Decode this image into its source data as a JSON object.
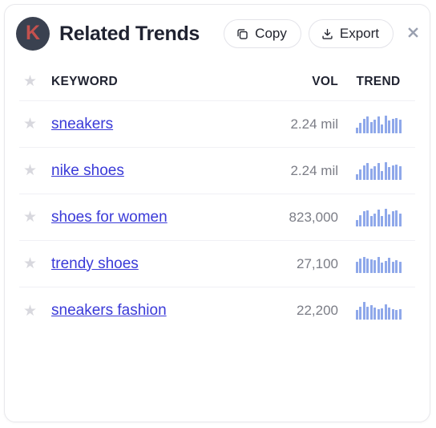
{
  "panel": {
    "logo_letter": "K",
    "logo_bg_color": "#3a4150",
    "logo_letter_color": "#c4514e",
    "title": "Related Trends"
  },
  "toolbar": {
    "copy_label": "Copy",
    "export_label": "Export",
    "copy_icon": "copy-icon",
    "export_icon": "download-icon",
    "close_icon": "close-icon"
  },
  "table": {
    "headers": {
      "star": "star-icon",
      "keyword": "KEYWORD",
      "vol": "VOL",
      "trend": "TREND"
    },
    "rows": [
      {
        "star": "star-icon",
        "keyword": "sneakers",
        "vol": "2.24 mil",
        "trend": [
          30,
          55,
          80,
          95,
          60,
          75,
          95,
          50,
          100,
          70,
          80,
          85,
          75
        ]
      },
      {
        "star": "star-icon",
        "keyword": "nike shoes",
        "vol": "2.24 mil",
        "trend": [
          30,
          55,
          80,
          95,
          60,
          75,
          95,
          50,
          100,
          70,
          80,
          85,
          75
        ]
      },
      {
        "star": "star-icon",
        "keyword": "shoes for women",
        "vol": "823,000",
        "trend": [
          35,
          60,
          85,
          90,
          55,
          70,
          95,
          55,
          100,
          65,
          85,
          90,
          70
        ]
      },
      {
        "star": "star-icon",
        "keyword": "trendy shoes",
        "vol": "27,100",
        "trend": [
          60,
          80,
          90,
          80,
          75,
          70,
          90,
          55,
          65,
          85,
          60,
          70,
          60
        ]
      },
      {
        "star": "star-icon",
        "keyword": "sneakers fashion",
        "vol": "22,200",
        "trend": [
          55,
          75,
          100,
          75,
          80,
          70,
          60,
          65,
          85,
          70,
          60,
          55,
          60
        ]
      }
    ]
  },
  "colors": {
    "link": "#3a3ad8",
    "spark_bar": "#8fa8ea",
    "vol_text": "#7b7d86",
    "divider": "#f0f0f5"
  }
}
